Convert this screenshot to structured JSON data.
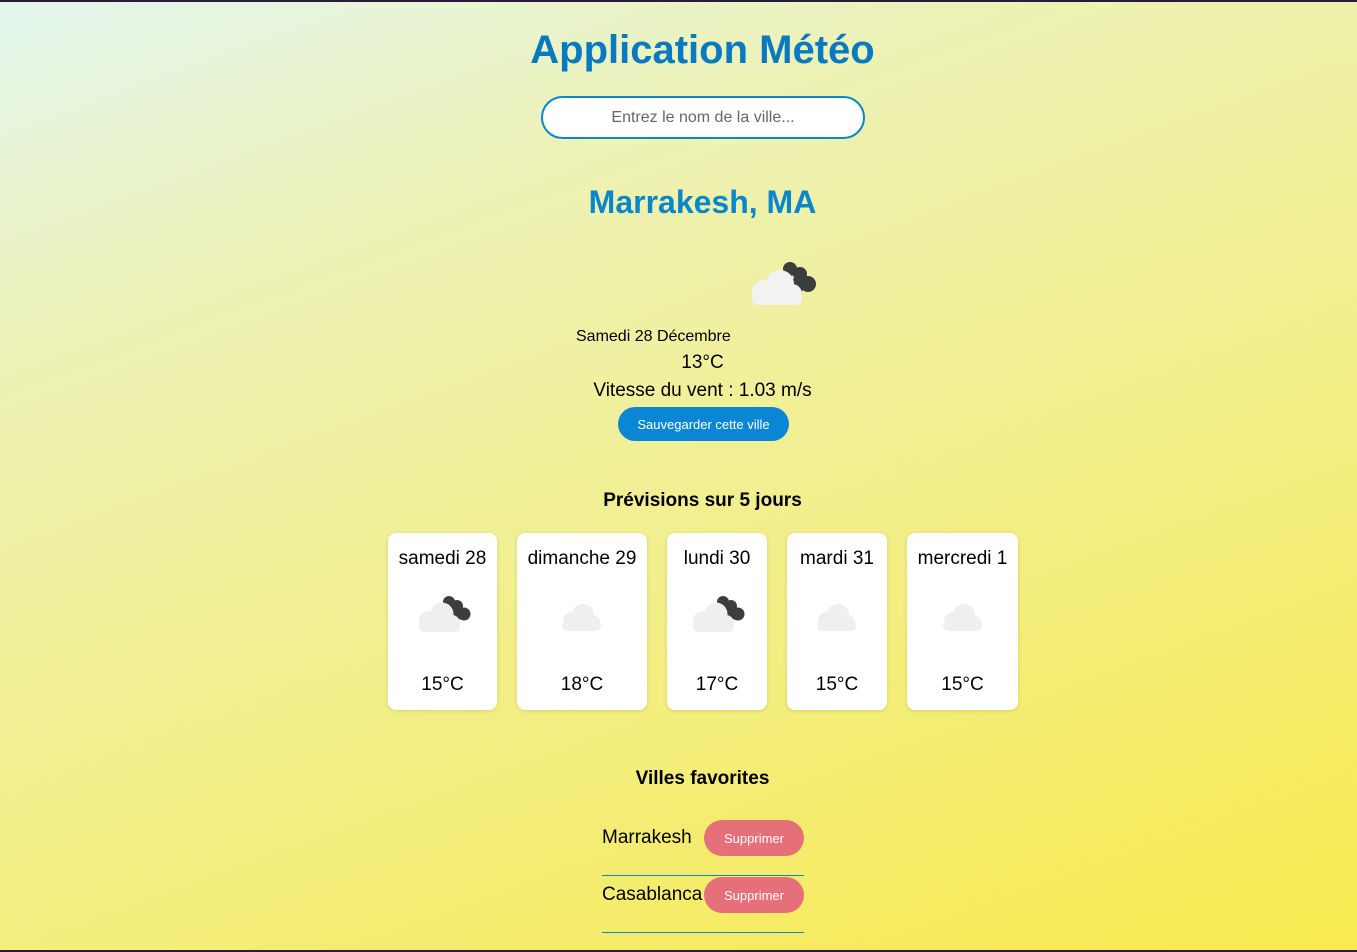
{
  "app": {
    "title": "Application Météo"
  },
  "search": {
    "placeholder": "Entrez le nom de la ville...",
    "value": ""
  },
  "current": {
    "city": "Marrakesh, MA",
    "icon": "partly-cloudy-night-icon",
    "date": "Samedi 28 Décembre",
    "temperature": "13°C",
    "wind": "Vitesse du vent : 1.03 m/s",
    "save_label": "Sauvegarder cette ville"
  },
  "forecast": {
    "title": "Prévisions sur 5 jours",
    "days": [
      {
        "day": "samedi 28",
        "icon": "partly-cloudy-night-icon",
        "temp": "15°C"
      },
      {
        "day": "dimanche 29",
        "icon": "cloud-icon",
        "temp": "18°C"
      },
      {
        "day": "lundi 30",
        "icon": "partly-cloudy-night-icon",
        "temp": "17°C"
      },
      {
        "day": "mardi 31",
        "icon": "cloud-icon",
        "temp": "15°C"
      },
      {
        "day": "mercredi 1",
        "icon": "cloud-icon",
        "temp": "15°C"
      }
    ]
  },
  "favorites": {
    "title": "Villes favorites",
    "delete_label": "Supprimer",
    "items": [
      {
        "name": "Marrakesh"
      },
      {
        "name": "Casablanca"
      }
    ]
  },
  "colors": {
    "accent": "#0a86cc",
    "title": "#0a7ac0",
    "save_button": "#0a86d4",
    "delete_button": "#e6707a"
  }
}
